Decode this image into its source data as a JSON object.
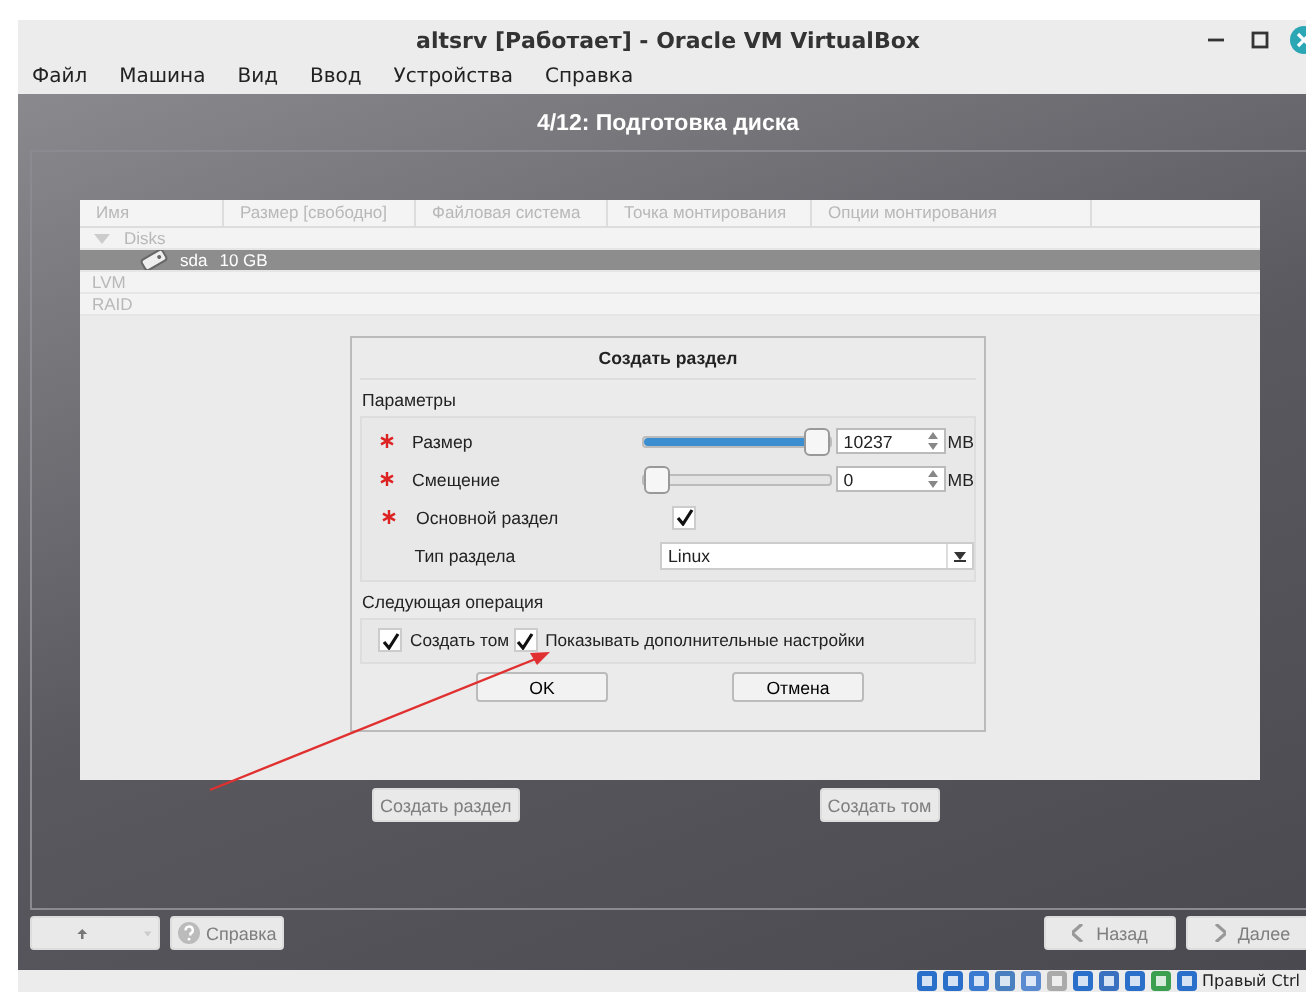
{
  "window": {
    "title": "altsrv [Работает] - Oracle VM VirtualBox"
  },
  "menu": [
    "Файл",
    "Машина",
    "Вид",
    "Ввод",
    "Устройства",
    "Справка"
  ],
  "installer": {
    "step_title": "4/12: Подготовка диска",
    "table": {
      "columns": [
        "Имя",
        "Размер [свободно]",
        "Файловая система",
        "Точка монтирования",
        "Опции монтирования"
      ],
      "rows": [
        {
          "name": "Disks",
          "expanded": true,
          "selected": false,
          "children": [
            {
              "name": "sda",
              "size": "10 GB",
              "selected": true
            }
          ]
        },
        {
          "name": "LVM",
          "selected": false
        },
        {
          "name": "RAID",
          "selected": false
        }
      ]
    },
    "actions": [
      "Создать раздел",
      "Создать том"
    ],
    "nav_left": {
      "help": "Справка"
    },
    "nav_right": [
      "Назад",
      "Далее"
    ]
  },
  "dialog": {
    "title": "Создать раздел",
    "parameters": {
      "title": "Параметры",
      "fields": [
        {
          "kind": "slider",
          "required": true,
          "label": "Размер",
          "level": 1.0,
          "value": "10237",
          "unit": "MB"
        },
        {
          "kind": "slider",
          "required": true,
          "label": "Смещение",
          "level": 0.0,
          "value": "0",
          "unit": "MB"
        },
        {
          "kind": "checkbox",
          "required": true,
          "label": "Основной раздел",
          "checked": true
        },
        {
          "kind": "select",
          "required": false,
          "label": "Тип раздела",
          "value": "Linux"
        }
      ]
    },
    "next_operation": {
      "title": "Следующая операция",
      "options": [
        {
          "label": "Создать том",
          "checked": true
        },
        {
          "label": "Показывать дополнительные настройки",
          "checked": true
        }
      ]
    },
    "buttons": [
      "OK",
      "Отмена"
    ]
  },
  "status_bar": {
    "host_key": "Правый Ctrl"
  }
}
